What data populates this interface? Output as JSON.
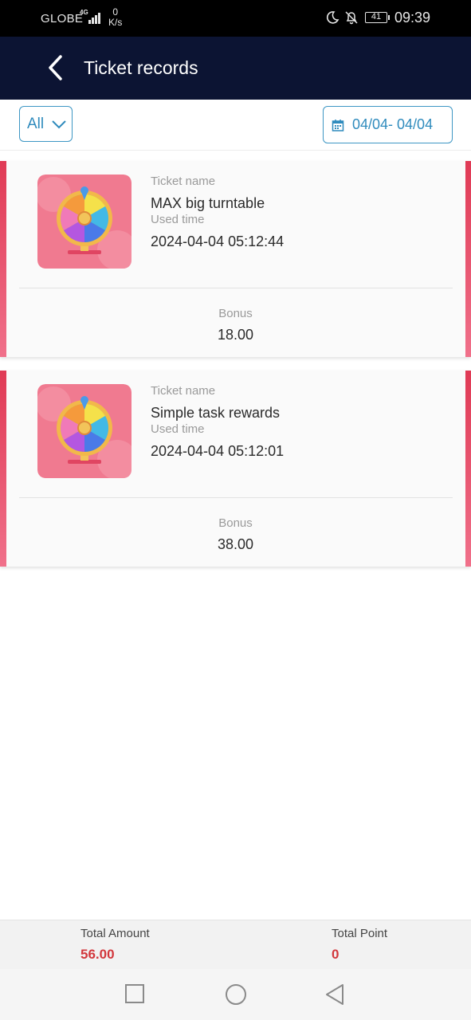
{
  "status_bar": {
    "carrier": "GLOBE",
    "network": "4G",
    "speed_value": "0",
    "speed_unit": "K/s",
    "battery": "41",
    "time": "09:39"
  },
  "header": {
    "title": "Ticket records",
    "back_icon": "chevron-left-icon"
  },
  "filters": {
    "type_label": "All",
    "date_range": "04/04- 04/04"
  },
  "records": [
    {
      "name_label": "Ticket name",
      "name": "MAX big turntable",
      "time_label": "Used time",
      "time": "2024-04-04 05:12:44",
      "bonus_label": "Bonus",
      "bonus": "18.00"
    },
    {
      "name_label": "Ticket name",
      "name": "Simple task rewards",
      "time_label": "Used time",
      "time": "2024-04-04 05:12:01",
      "bonus_label": "Bonus",
      "bonus": "38.00"
    }
  ],
  "totals": {
    "amount_label": "Total Amount",
    "amount": "56.00",
    "point_label": "Total Point",
    "point": "0"
  },
  "colors": {
    "header_bg": "#0c1433",
    "accent": "#3d96c4",
    "card_accent": "#e03a55",
    "total_value": "#d2373c"
  }
}
